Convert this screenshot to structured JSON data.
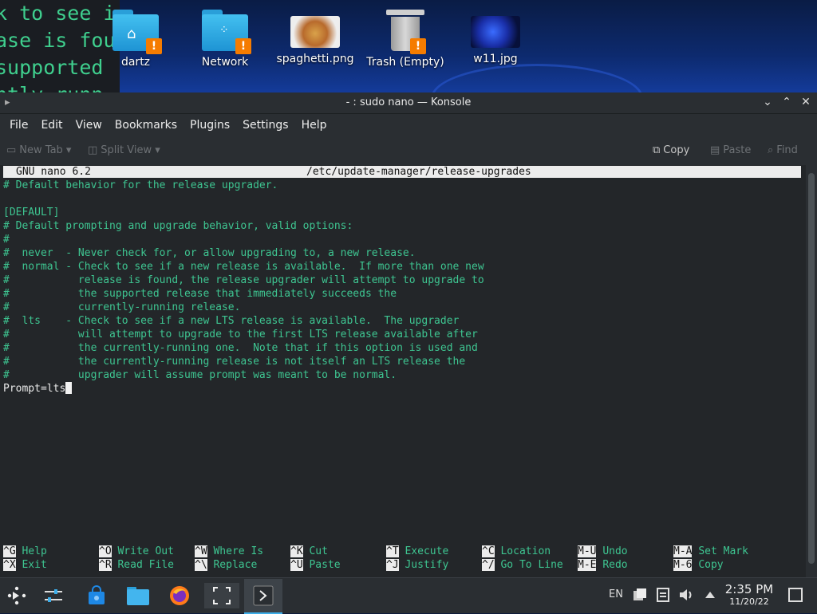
{
  "desktop": {
    "bg_terminal_lines": [
      "k to see i",
      "ase is fou",
      "supported",
      "ntly-runn"
    ],
    "icons": [
      {
        "label": "dartz"
      },
      {
        "label": "Network"
      },
      {
        "label": "spaghetti.png"
      },
      {
        "label": "Trash (Empty)"
      },
      {
        "label": "w11.jpg"
      }
    ]
  },
  "window": {
    "title": "- : sudo nano — Konsole",
    "menu": [
      "File",
      "Edit",
      "View",
      "Bookmarks",
      "Plugins",
      "Settings",
      "Help"
    ],
    "toolbar": {
      "new_tab": "New Tab",
      "split_view": "Split View",
      "copy": "Copy",
      "paste": "Paste",
      "find": "Find"
    }
  },
  "nano": {
    "version": "GNU nano 6.2",
    "file": "/etc/update-manager/release-upgrades",
    "lines": [
      "# Default behavior for the release upgrader.",
      "",
      "[DEFAULT]",
      "# Default prompting and upgrade behavior, valid options:",
      "#",
      "#  never  - Never check for, or allow upgrading to, a new release.",
      "#  normal - Check to see if a new release is available.  If more than one new",
      "#           release is found, the release upgrader will attempt to upgrade to",
      "#           the supported release that immediately succeeds the",
      "#           currently-running release.",
      "#  lts    - Check to see if a new LTS release is available.  The upgrader",
      "#           will attempt to upgrade to the first LTS release available after",
      "#           the currently-running one.  Note that if this option is used and",
      "#           the currently-running release is not itself an LTS release the",
      "#           upgrader will assume prompt was meant to be normal."
    ],
    "prompt_line": "Prompt=lts",
    "shortcuts": [
      {
        "key": "^G",
        "label": "Help"
      },
      {
        "key": "^X",
        "label": "Exit"
      },
      {
        "key": "^O",
        "label": "Write Out"
      },
      {
        "key": "^R",
        "label": "Read File"
      },
      {
        "key": "^W",
        "label": "Where Is"
      },
      {
        "key": "^\\",
        "label": "Replace"
      },
      {
        "key": "^K",
        "label": "Cut"
      },
      {
        "key": "^U",
        "label": "Paste"
      },
      {
        "key": "^T",
        "label": "Execute"
      },
      {
        "key": "^J",
        "label": "Justify"
      },
      {
        "key": "^C",
        "label": "Location"
      },
      {
        "key": "^/",
        "label": "Go To Line"
      },
      {
        "key": "M-U",
        "label": "Undo"
      },
      {
        "key": "M-E",
        "label": "Redo"
      },
      {
        "key": "M-A",
        "label": "Set Mark"
      },
      {
        "key": "M-6",
        "label": "Copy"
      }
    ]
  },
  "taskbar": {
    "lang": "EN",
    "time": "2:35 PM",
    "date": "11/20/22"
  },
  "colors": {
    "terminal_text": "#3ec591",
    "accent": "#3daee9",
    "warning_badge": "#f57c00"
  }
}
